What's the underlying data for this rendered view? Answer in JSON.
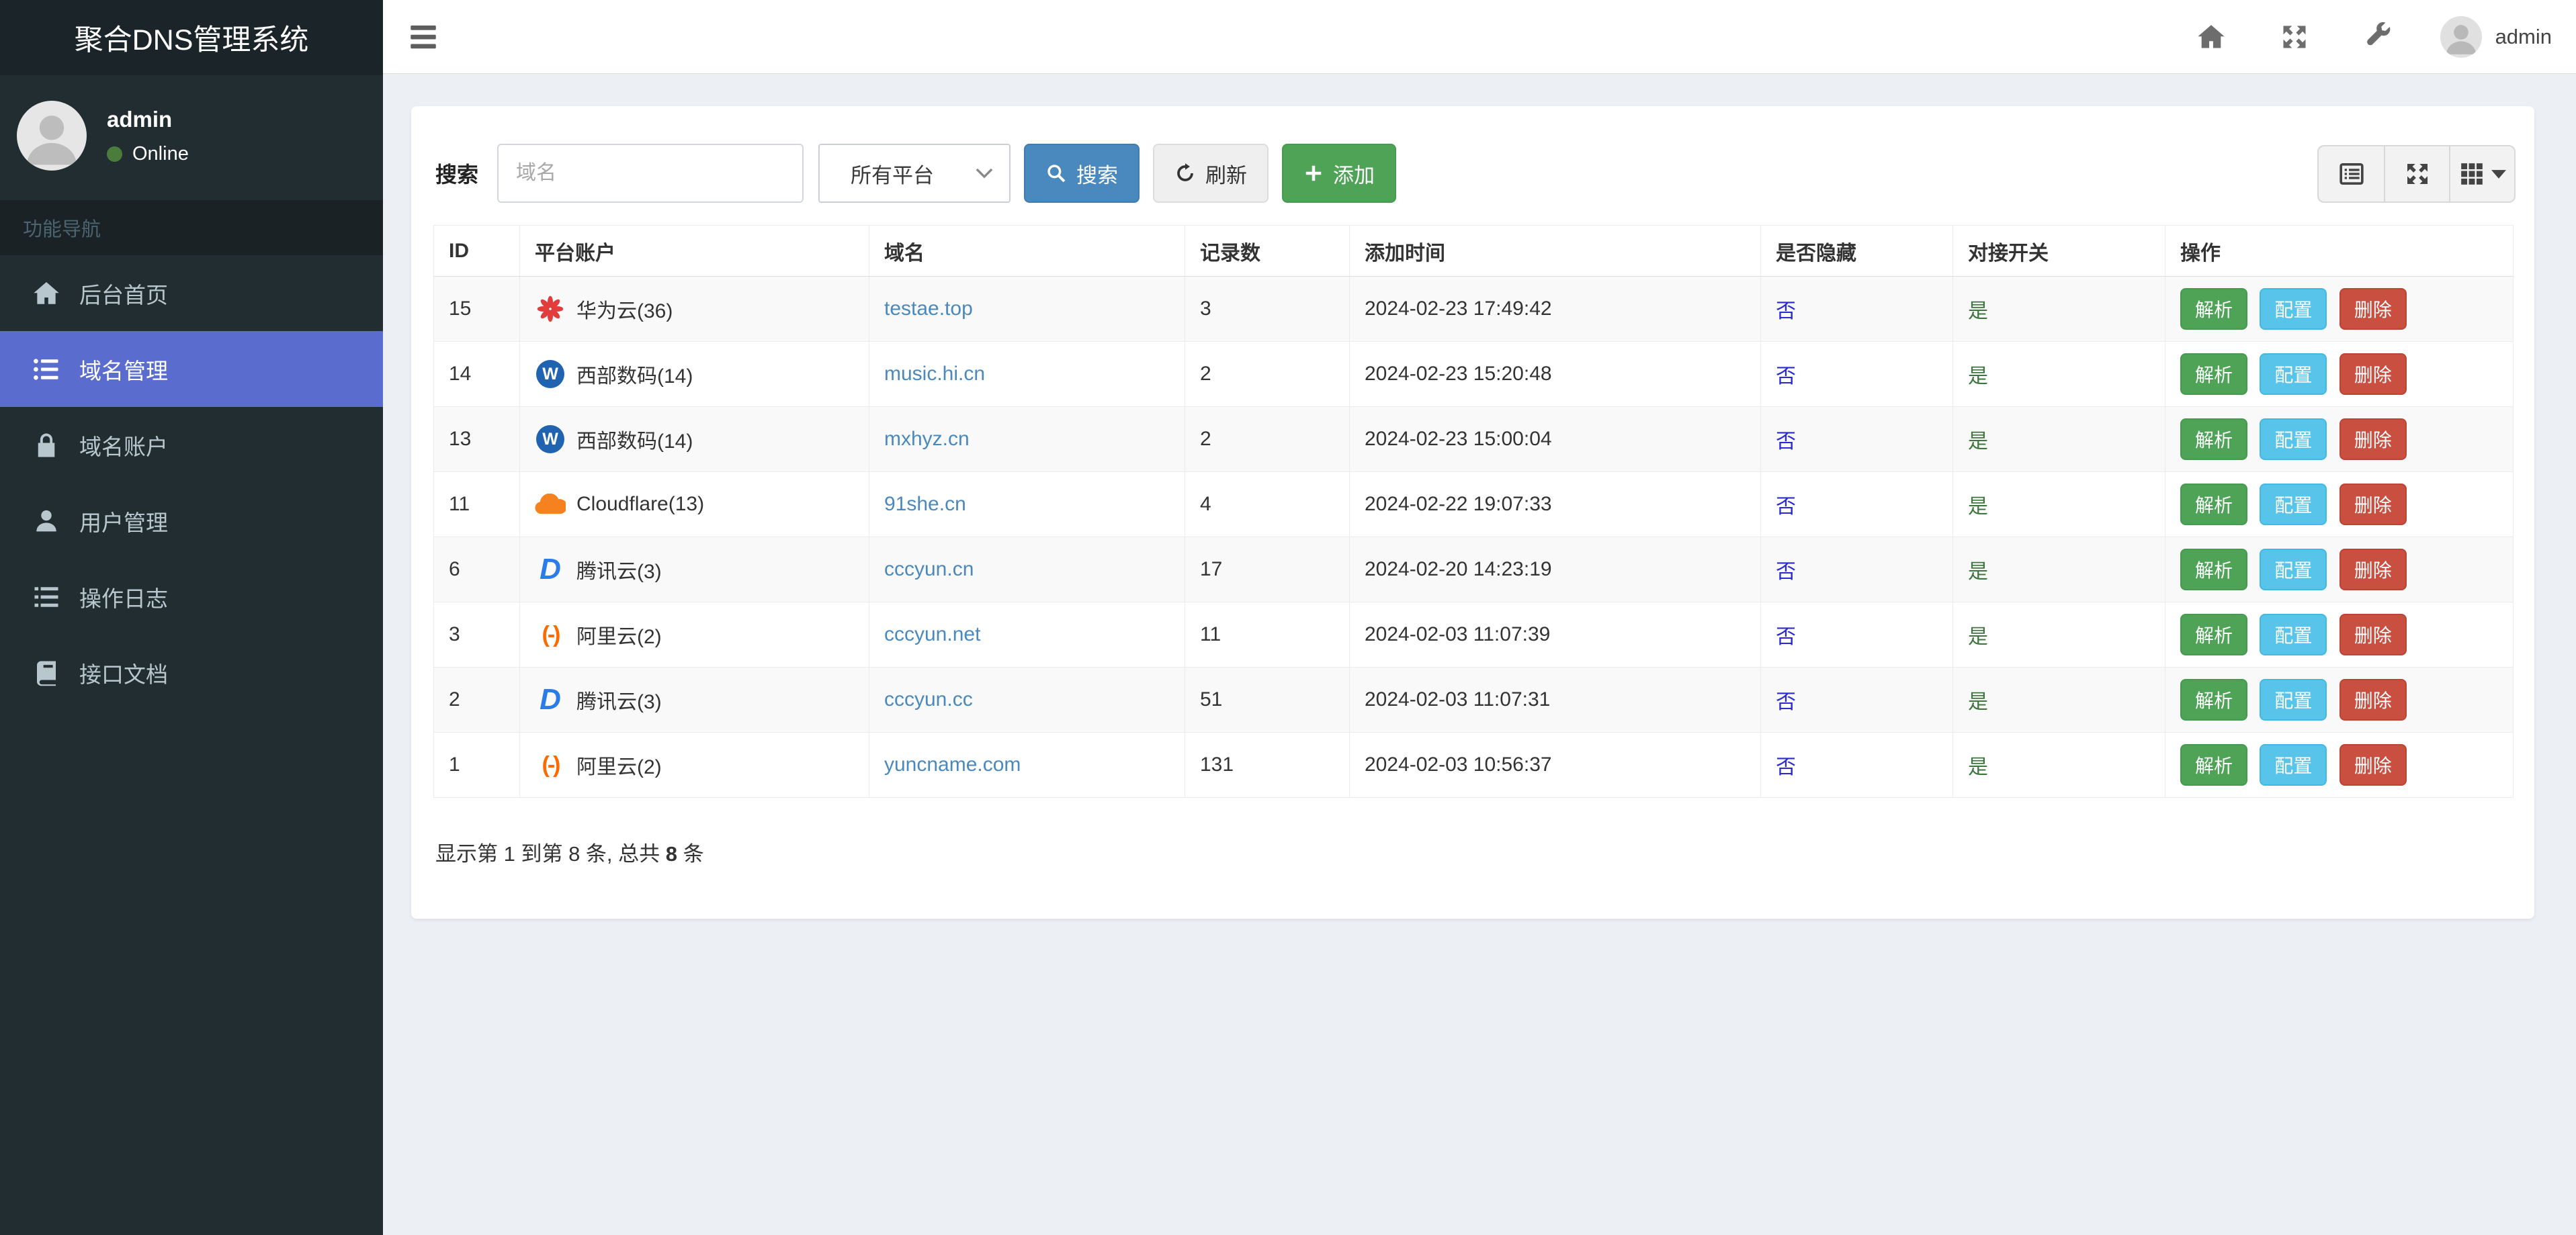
{
  "app": {
    "title": "聚合DNS管理系统"
  },
  "sidebar": {
    "user": {
      "name": "admin",
      "status": "Online"
    },
    "nav_header": "功能导航",
    "items": [
      {
        "label": "后台首页",
        "icon": "home-icon",
        "active": false
      },
      {
        "label": "域名管理",
        "icon": "list-icon",
        "active": true
      },
      {
        "label": "域名账户",
        "icon": "lock-icon",
        "active": false
      },
      {
        "label": "用户管理",
        "icon": "user-icon",
        "active": false
      },
      {
        "label": "操作日志",
        "icon": "logs-icon",
        "active": false
      },
      {
        "label": "接口文档",
        "icon": "book-icon",
        "active": false
      }
    ]
  },
  "topbar": {
    "username": "admin"
  },
  "toolbar": {
    "search_label": "搜索",
    "domain_placeholder": "域名",
    "platform_select_value": "所有平台",
    "search_button": "搜索",
    "refresh_button": "刷新",
    "add_button": "添加"
  },
  "table": {
    "columns": [
      "ID",
      "平台账户",
      "域名",
      "记录数",
      "添加时间",
      "是否隐藏",
      "对接开关",
      "操作"
    ],
    "action_labels": {
      "resolve": "解析",
      "config": "配置",
      "delete": "删除"
    },
    "rows": [
      {
        "id": "15",
        "platform": "华为云(36)",
        "platform_icon": "huawei-cloud-icon",
        "domain": "testae.top",
        "records": "3",
        "time": "2024-02-23 17:49:42",
        "hidden": "否",
        "switch": "是"
      },
      {
        "id": "14",
        "platform": "西部数码(14)",
        "platform_icon": "west-digital-icon",
        "domain": "music.hi.cn",
        "records": "2",
        "time": "2024-02-23 15:20:48",
        "hidden": "否",
        "switch": "是"
      },
      {
        "id": "13",
        "platform": "西部数码(14)",
        "platform_icon": "west-digital-icon",
        "domain": "mxhyz.cn",
        "records": "2",
        "time": "2024-02-23 15:00:04",
        "hidden": "否",
        "switch": "是"
      },
      {
        "id": "11",
        "platform": "Cloudflare(13)",
        "platform_icon": "cloudflare-icon",
        "domain": "91she.cn",
        "records": "4",
        "time": "2024-02-22 19:07:33",
        "hidden": "否",
        "switch": "是"
      },
      {
        "id": "6",
        "platform": "腾讯云(3)",
        "platform_icon": "tencent-dnspod-icon",
        "domain": "cccyun.cn",
        "records": "17",
        "time": "2024-02-20 14:23:19",
        "hidden": "否",
        "switch": "是"
      },
      {
        "id": "3",
        "platform": "阿里云(2)",
        "platform_icon": "aliyun-icon",
        "domain": "cccyun.net",
        "records": "11",
        "time": "2024-02-03 11:07:39",
        "hidden": "否",
        "switch": "是"
      },
      {
        "id": "2",
        "platform": "腾讯云(3)",
        "platform_icon": "tencent-dnspod-icon",
        "domain": "cccyun.cc",
        "records": "51",
        "time": "2024-02-03 11:07:31",
        "hidden": "否",
        "switch": "是"
      },
      {
        "id": "1",
        "platform": "阿里云(2)",
        "platform_icon": "aliyun-icon",
        "domain": "yuncname.com",
        "records": "131",
        "time": "2024-02-03 10:56:37",
        "hidden": "否",
        "switch": "是"
      }
    ],
    "summary": {
      "prefix": "显示第 1 到第 8 条, 总共 ",
      "total": "8",
      "suffix": " 条"
    }
  },
  "colors": {
    "primary": "#4a89bd",
    "primary_border": "#3f7cb0",
    "success": "#4ea357",
    "success_border": "#459a4d",
    "info": "#58c4ea",
    "info_border": "#41b9e2",
    "danger": "#c94f41",
    "danger_border": "#bd4335",
    "link": "#4a89bd",
    "hidden_no": "#2a2ad4",
    "switch_yes": "#3c763d",
    "sidebar": "#222d32",
    "sidebar_logo": "#1b2529",
    "sidebar_header": "#1a2226",
    "sidebar_header_text": "#4b646f",
    "nav_text": "#b8c7ce",
    "nav_active": "#5a6cce",
    "page_bg": "#ecf0f5",
    "online_dot": "#4a7c3b"
  }
}
